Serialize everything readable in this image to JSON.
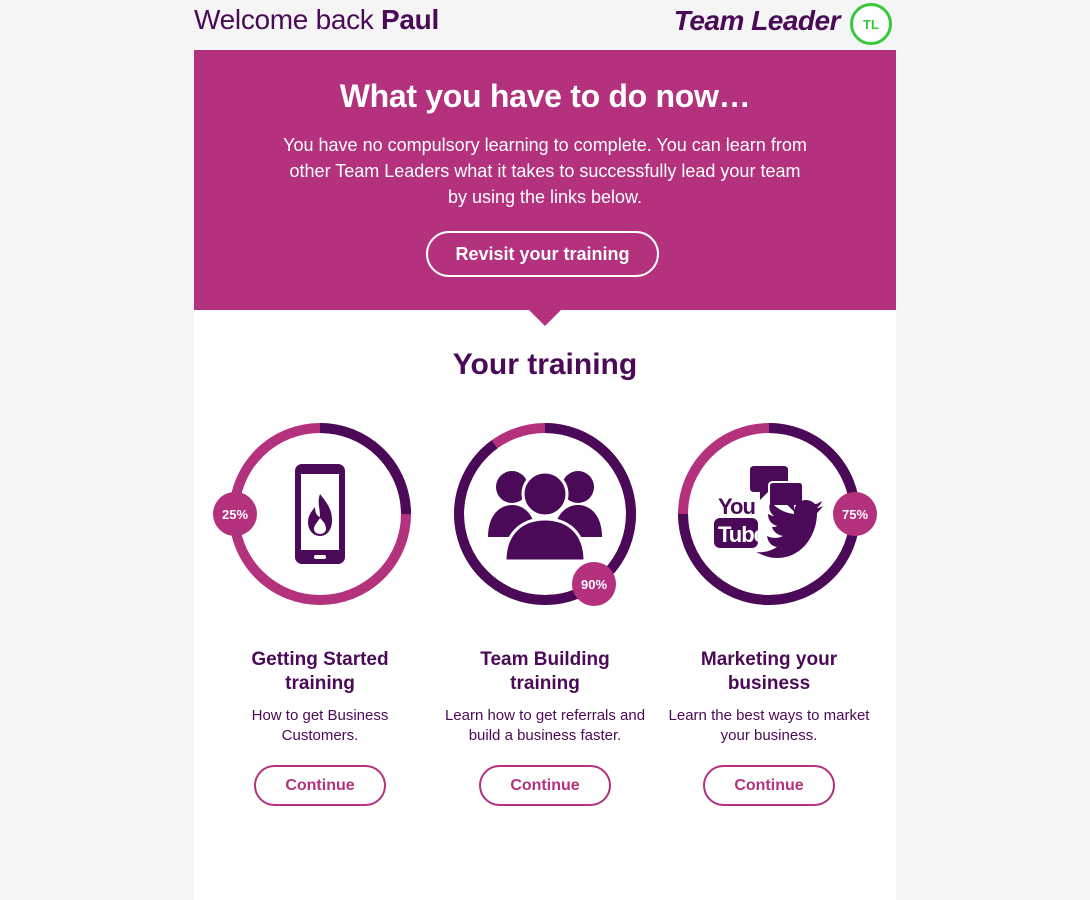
{
  "header": {
    "welcome_prefix": "Welcome back",
    "user_name": "Paul",
    "brand": "Team Leader",
    "badge": "TL"
  },
  "banner": {
    "title": "What you have to do now…",
    "message": "You have no compulsory learning to complete. You can learn from other Team Leaders what it takes to successfully lead your team by using the links below.",
    "button_label": "Revisit your training"
  },
  "training": {
    "title": "Your training",
    "cards": [
      {
        "title": "Getting Started training",
        "description": "How to get Business Customers.",
        "progress_label": "25%",
        "progress": 0.25,
        "icon": "smartphone-flame-icon",
        "button_label": "Continue"
      },
      {
        "title": "Team Building training",
        "description": "Learn how to get referrals and build a business faster.",
        "progress_label": "90%",
        "progress": 0.9,
        "icon": "team-people-icon",
        "button_label": "Continue"
      },
      {
        "title": "Marketing your business",
        "description": "Learn the best ways to market your business.",
        "progress_label": "75%",
        "progress": 0.75,
        "icon": "social-media-icon",
        "button_label": "Continue"
      }
    ]
  },
  "colors": {
    "primary": "#4b0a57",
    "accent": "#b3317d",
    "badge_green": "#3cc83c",
    "background": "#f5f5f5"
  }
}
